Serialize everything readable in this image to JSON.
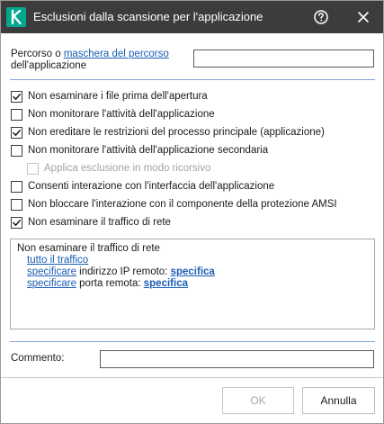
{
  "window": {
    "title": "Esclusioni dalla scansione per l'applicazione",
    "colors": {
      "titlebar": "#3c3c3c",
      "logo": "#00a88e",
      "link": "#1a5db3"
    },
    "icons": {
      "logo": "kaspersky-k-icon",
      "help": "help-circle-icon",
      "close": "close-icon"
    }
  },
  "path": {
    "label_prefix": "Percorso o ",
    "label_link": "maschera del percorso",
    "label_suffix": "dell'applicazione",
    "value": ""
  },
  "options": [
    {
      "label": "Non esaminare i file prima dell'apertura",
      "checked": true,
      "disabled": false
    },
    {
      "label": "Non monitorare l'attività dell'applicazione",
      "checked": false,
      "disabled": false
    },
    {
      "label": "Non ereditare le restrizioni del processo principale (applicazione)",
      "checked": true,
      "disabled": false
    },
    {
      "label": "Non monitorare l'attività dell'applicazione secondaria",
      "checked": false,
      "disabled": false
    },
    {
      "label": "Applica esclusione in modo ricorsivo",
      "checked": false,
      "disabled": true
    },
    {
      "label": "Consenti interazione con l'interfaccia dell'applicazione",
      "checked": false,
      "disabled": false
    },
    {
      "label": "Non bloccare l'interazione con il componente della protezione AMSI",
      "checked": false,
      "disabled": false
    },
    {
      "label": "Non esaminare il traffico di rete",
      "checked": true,
      "disabled": false
    }
  ],
  "description": {
    "title": "Non esaminare il traffico di rete",
    "line1_link": "tutto il traffico",
    "line2_link": "specificare",
    "line2_text": " indirizzo IP remoto: ",
    "line2_value": "specifica",
    "line3_link": "specificare",
    "line3_text": " porta remota: ",
    "line3_value": "specifica"
  },
  "comment": {
    "label": "Commento:",
    "value": ""
  },
  "buttons": {
    "ok": "OK",
    "cancel": "Annulla"
  }
}
